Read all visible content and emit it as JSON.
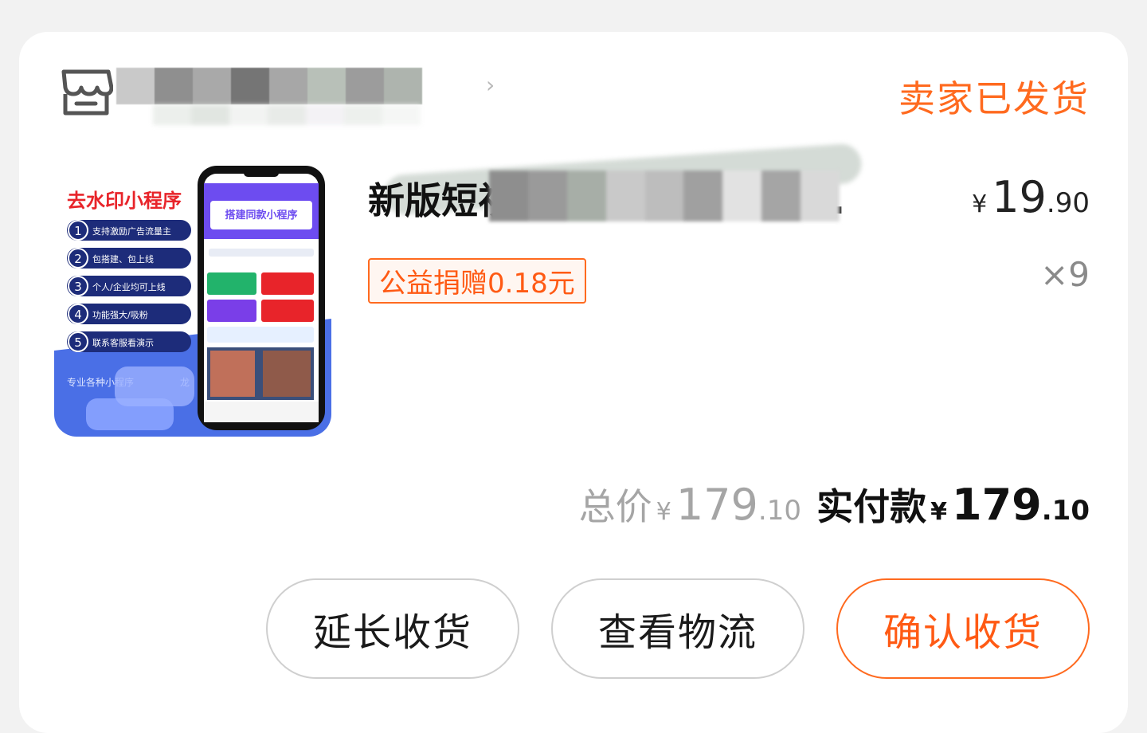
{
  "store": {
    "name_redacted": "",
    "icon": "store-icon",
    "chevron": "›"
  },
  "order_status": "卖家已发货",
  "product": {
    "title": "新版短视频去水印小程序解…",
    "unit_price": {
      "symbol": "¥",
      "int": "19",
      "dec": ".90"
    },
    "donation": "公益捐赠0.18元",
    "quantity": "×9",
    "thumbnail": {
      "heading": "去水印小程序",
      "features": [
        {
          "num": "1",
          "text": "支持激励广告流量主"
        },
        {
          "num": "2",
          "text": "包搭建、包上线"
        },
        {
          "num": "3",
          "text": "个人/企业均可上线"
        },
        {
          "num": "4",
          "text": "功能强大/吸粉"
        },
        {
          "num": "5",
          "text": "联系客服看演示"
        }
      ],
      "banner_text": "专业各种小程序",
      "banner_suffix": "龙",
      "phone_title": "搭建同款小程序"
    }
  },
  "totals": {
    "total_label": "总价",
    "total": {
      "symbol": "¥",
      "int": "179",
      "dec": ".10"
    },
    "paid_label": "实付款",
    "paid": {
      "symbol": "¥",
      "int": "179",
      "dec": ".10"
    }
  },
  "buttons": {
    "extend": "延长收货",
    "logistics": "查看物流",
    "confirm": "确认收货"
  },
  "colors": {
    "accent": "#ff6a1f",
    "background": "#f2f2f2",
    "card": "#ffffff",
    "thumb_blue": "#4a6fe6",
    "thumb_navy": "#1d2c7a",
    "thumb_red": "#e8242a"
  }
}
